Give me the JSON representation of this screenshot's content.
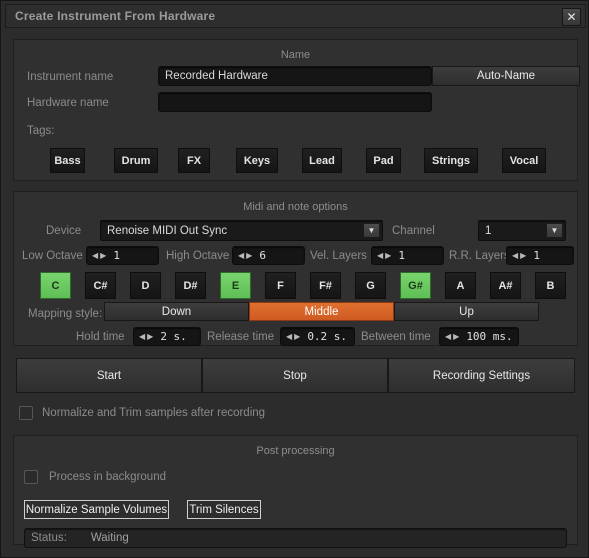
{
  "window": {
    "title": "Create Instrument From Hardware",
    "close_icon": "close-icon",
    "close_glyph": "✕"
  },
  "name_section": {
    "title": "Name",
    "instrument_name_label": "Instrument name",
    "instrument_name_value": "Recorded Hardware",
    "hardware_name_label": "Hardware name",
    "hardware_name_value": "",
    "auto_name_label": "Auto-Name",
    "tags_label": "Tags:",
    "tags": [
      "Bass",
      "Drum",
      "FX",
      "Keys",
      "Lead",
      "Pad",
      "Strings",
      "Vocal"
    ]
  },
  "midi_section": {
    "title": "Midi and note options",
    "device_label": "Device",
    "device_value": "Renoise MIDI Out Sync",
    "channel_label": "Channel",
    "channel_value": "1",
    "low_octave_label": "Low Octave",
    "low_octave_value": "1",
    "high_octave_label": "High Octave",
    "high_octave_value": "6",
    "vel_layers_label": "Vel. Layers",
    "vel_layers_value": "1",
    "rr_layers_label": "R.R. Layers",
    "rr_layers_value": "1",
    "notes": [
      {
        "label": "C",
        "selected": true
      },
      {
        "label": "C#",
        "selected": false
      },
      {
        "label": "D",
        "selected": false
      },
      {
        "label": "D#",
        "selected": false
      },
      {
        "label": "E",
        "selected": true
      },
      {
        "label": "F",
        "selected": false
      },
      {
        "label": "F#",
        "selected": false
      },
      {
        "label": "G",
        "selected": false
      },
      {
        "label": "G#",
        "selected": true
      },
      {
        "label": "A",
        "selected": false
      },
      {
        "label": "A#",
        "selected": false
      },
      {
        "label": "B",
        "selected": false
      }
    ],
    "mapping_style_label": "Mapping style:",
    "mapping_styles": [
      {
        "label": "Down",
        "selected": false
      },
      {
        "label": "Middle",
        "selected": true
      },
      {
        "label": "Up",
        "selected": false
      }
    ],
    "hold_time_label": "Hold time",
    "hold_time_value": "2 s.",
    "release_time_label": "Release time",
    "release_time_value": "0.2 s.",
    "between_time_label": "Between time",
    "between_time_value": "100 ms."
  },
  "transport": {
    "start_label": "Start",
    "stop_label": "Stop",
    "recording_settings_label": "Recording Settings",
    "normalize_trim_label": "Normalize and Trim samples after recording",
    "normalize_trim_checked": false
  },
  "post_processing": {
    "title": "Post processing",
    "process_in_background_label": "Process in background",
    "process_in_background_checked": false,
    "normalize_sample_volumes_label": "Normalize Sample Volumes",
    "trim_silences_label": "Trim Silences",
    "status_label": "Status:",
    "status_value": "Waiting"
  },
  "glyphs": {
    "left_arrow": "◀",
    "right_arrow": "▶",
    "down_arrow": "▼"
  },
  "colors": {
    "accent_selected": "#d4622c",
    "note_selected": "#6bcb62",
    "window_bg": "#2c2c2c",
    "panel_bg": "#303030"
  }
}
